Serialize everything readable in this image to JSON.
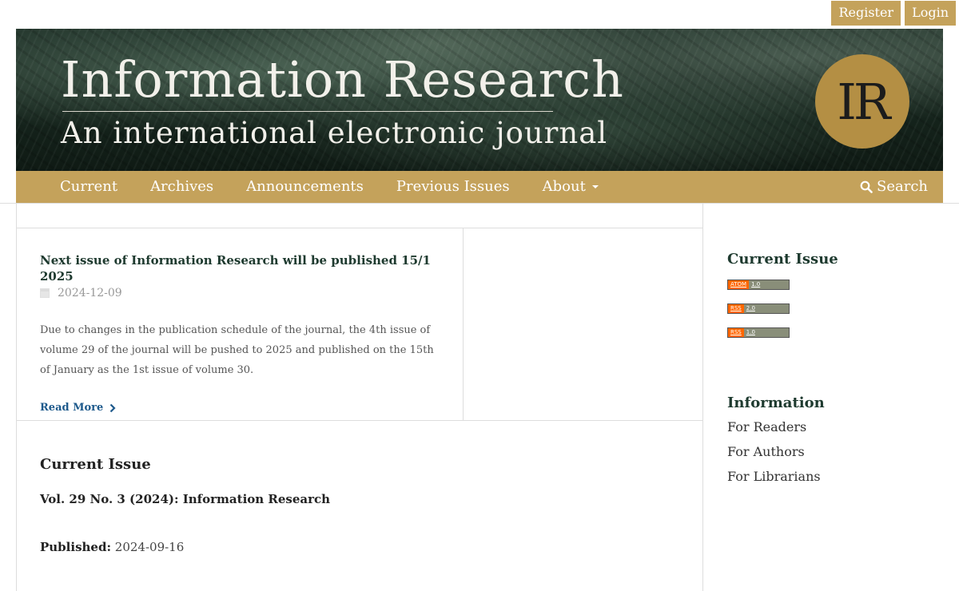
{
  "user_nav": {
    "register": "Register",
    "login": "Login"
  },
  "header": {
    "title": "Information Research",
    "subtitle": "An international electronic journal",
    "logo_text": "IR",
    "logo_color": "#b48f44"
  },
  "main_nav": {
    "items": [
      {
        "label": "Current"
      },
      {
        "label": "Archives"
      },
      {
        "label": "Announcements"
      },
      {
        "label": "Previous Issues"
      },
      {
        "label": "About"
      }
    ],
    "search_label": "Search",
    "accent_color": "#c4a25b"
  },
  "announcement": {
    "title": "Next issue of Information Research will be published 15/1 2025",
    "date": "2024-12-09",
    "body": "Due to changes in the publication schedule of the journal, the 4th issue of volume 29 of the journal will be pushed to 2025 and published on the 15th of January as the 1st issue of volume 30.",
    "read_more": "Read More"
  },
  "current_issue": {
    "heading": "Current Issue",
    "issue_title": "Vol. 29 No. 3 (2024): Information Research",
    "published_label": "Published:",
    "published_date": "2024-09-16"
  },
  "sidebar": {
    "current_issue_heading": "Current Issue",
    "feeds": [
      {
        "left": "ATOM",
        "right": "1.0"
      },
      {
        "left": "RSS",
        "right": "2.0"
      },
      {
        "left": "RSS",
        "right": "1.0"
      }
    ],
    "information_heading": "Information",
    "info_links": [
      {
        "label": "For Readers"
      },
      {
        "label": "For Authors"
      },
      {
        "label": "For Librarians"
      }
    ]
  }
}
